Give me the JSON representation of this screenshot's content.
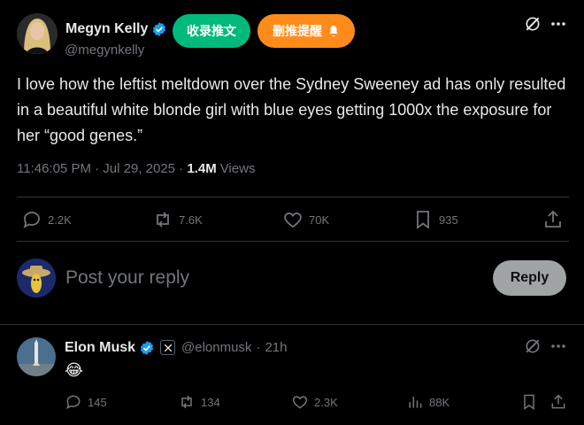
{
  "tweet": {
    "author_name": "Megyn Kelly",
    "author_handle": "@megynkelly",
    "text": "I love how the leftist meltdown over the Sydney Sweeney ad has only resulted in a beautiful white blonde girl with blue eyes getting 1000x the exposure for her “good genes.”",
    "time": "11:46:05 PM · Jul 29, 2025 · ",
    "views_count": "1.4M",
    "views_label": "Views",
    "replies": "2.2K",
    "reposts": "7.6K",
    "likes": "70K",
    "bookmarks": "935"
  },
  "extension": {
    "collect_label": "收录推文",
    "delete_label": "删推提醒",
    "collect_color": "#00ba7c",
    "delete_color": "#ff8c1a"
  },
  "composer": {
    "placeholder": "Post your reply",
    "reply_label": "Reply"
  },
  "reply": {
    "author_name": "Elon Musk",
    "author_handle": "@elonmusk",
    "separator": "·",
    "age": "21h",
    "emoji": "😂",
    "replies": "145",
    "reposts": "134",
    "likes": "2.3K",
    "views": "88K"
  },
  "colors": {
    "accent": "#1d9bf0",
    "background": "#000000",
    "muted": "#71767b"
  }
}
